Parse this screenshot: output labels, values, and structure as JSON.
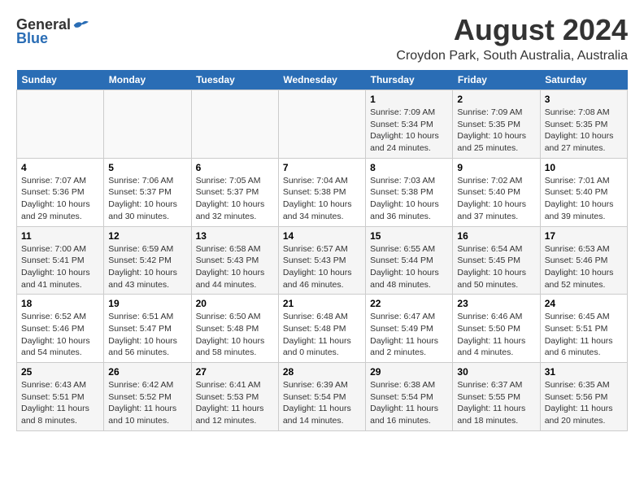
{
  "header": {
    "logo_general": "General",
    "logo_blue": "Blue",
    "month_year": "August 2024",
    "location": "Croydon Park, South Australia, Australia"
  },
  "weekdays": [
    "Sunday",
    "Monday",
    "Tuesday",
    "Wednesday",
    "Thursday",
    "Friday",
    "Saturday"
  ],
  "weeks": [
    [
      {
        "day": "",
        "detail": ""
      },
      {
        "day": "",
        "detail": ""
      },
      {
        "day": "",
        "detail": ""
      },
      {
        "day": "",
        "detail": ""
      },
      {
        "day": "1",
        "detail": "Sunrise: 7:09 AM\nSunset: 5:34 PM\nDaylight: 10 hours and 24 minutes."
      },
      {
        "day": "2",
        "detail": "Sunrise: 7:09 AM\nSunset: 5:35 PM\nDaylight: 10 hours and 25 minutes."
      },
      {
        "day": "3",
        "detail": "Sunrise: 7:08 AM\nSunset: 5:35 PM\nDaylight: 10 hours and 27 minutes."
      }
    ],
    [
      {
        "day": "4",
        "detail": "Sunrise: 7:07 AM\nSunset: 5:36 PM\nDaylight: 10 hours and 29 minutes."
      },
      {
        "day": "5",
        "detail": "Sunrise: 7:06 AM\nSunset: 5:37 PM\nDaylight: 10 hours and 30 minutes."
      },
      {
        "day": "6",
        "detail": "Sunrise: 7:05 AM\nSunset: 5:37 PM\nDaylight: 10 hours and 32 minutes."
      },
      {
        "day": "7",
        "detail": "Sunrise: 7:04 AM\nSunset: 5:38 PM\nDaylight: 10 hours and 34 minutes."
      },
      {
        "day": "8",
        "detail": "Sunrise: 7:03 AM\nSunset: 5:38 PM\nDaylight: 10 hours and 36 minutes."
      },
      {
        "day": "9",
        "detail": "Sunrise: 7:02 AM\nSunset: 5:40 PM\nDaylight: 10 hours and 37 minutes."
      },
      {
        "day": "10",
        "detail": "Sunrise: 7:01 AM\nSunset: 5:40 PM\nDaylight: 10 hours and 39 minutes."
      }
    ],
    [
      {
        "day": "11",
        "detail": "Sunrise: 7:00 AM\nSunset: 5:41 PM\nDaylight: 10 hours and 41 minutes."
      },
      {
        "day": "12",
        "detail": "Sunrise: 6:59 AM\nSunset: 5:42 PM\nDaylight: 10 hours and 43 minutes."
      },
      {
        "day": "13",
        "detail": "Sunrise: 6:58 AM\nSunset: 5:43 PM\nDaylight: 10 hours and 44 minutes."
      },
      {
        "day": "14",
        "detail": "Sunrise: 6:57 AM\nSunset: 5:43 PM\nDaylight: 10 hours and 46 minutes."
      },
      {
        "day": "15",
        "detail": "Sunrise: 6:55 AM\nSunset: 5:44 PM\nDaylight: 10 hours and 48 minutes."
      },
      {
        "day": "16",
        "detail": "Sunrise: 6:54 AM\nSunset: 5:45 PM\nDaylight: 10 hours and 50 minutes."
      },
      {
        "day": "17",
        "detail": "Sunrise: 6:53 AM\nSunset: 5:46 PM\nDaylight: 10 hours and 52 minutes."
      }
    ],
    [
      {
        "day": "18",
        "detail": "Sunrise: 6:52 AM\nSunset: 5:46 PM\nDaylight: 10 hours and 54 minutes."
      },
      {
        "day": "19",
        "detail": "Sunrise: 6:51 AM\nSunset: 5:47 PM\nDaylight: 10 hours and 56 minutes."
      },
      {
        "day": "20",
        "detail": "Sunrise: 6:50 AM\nSunset: 5:48 PM\nDaylight: 10 hours and 58 minutes."
      },
      {
        "day": "21",
        "detail": "Sunrise: 6:48 AM\nSunset: 5:48 PM\nDaylight: 11 hours and 0 minutes."
      },
      {
        "day": "22",
        "detail": "Sunrise: 6:47 AM\nSunset: 5:49 PM\nDaylight: 11 hours and 2 minutes."
      },
      {
        "day": "23",
        "detail": "Sunrise: 6:46 AM\nSunset: 5:50 PM\nDaylight: 11 hours and 4 minutes."
      },
      {
        "day": "24",
        "detail": "Sunrise: 6:45 AM\nSunset: 5:51 PM\nDaylight: 11 hours and 6 minutes."
      }
    ],
    [
      {
        "day": "25",
        "detail": "Sunrise: 6:43 AM\nSunset: 5:51 PM\nDaylight: 11 hours and 8 minutes."
      },
      {
        "day": "26",
        "detail": "Sunrise: 6:42 AM\nSunset: 5:52 PM\nDaylight: 11 hours and 10 minutes."
      },
      {
        "day": "27",
        "detail": "Sunrise: 6:41 AM\nSunset: 5:53 PM\nDaylight: 11 hours and 12 minutes."
      },
      {
        "day": "28",
        "detail": "Sunrise: 6:39 AM\nSunset: 5:54 PM\nDaylight: 11 hours and 14 minutes."
      },
      {
        "day": "29",
        "detail": "Sunrise: 6:38 AM\nSunset: 5:54 PM\nDaylight: 11 hours and 16 minutes."
      },
      {
        "day": "30",
        "detail": "Sunrise: 6:37 AM\nSunset: 5:55 PM\nDaylight: 11 hours and 18 minutes."
      },
      {
        "day": "31",
        "detail": "Sunrise: 6:35 AM\nSunset: 5:56 PM\nDaylight: 11 hours and 20 minutes."
      }
    ]
  ]
}
